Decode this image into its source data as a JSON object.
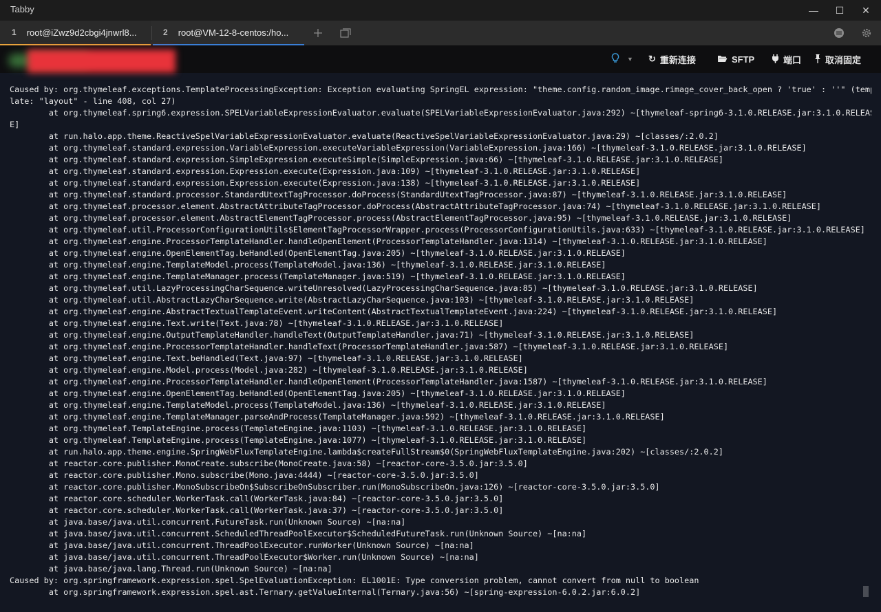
{
  "app": {
    "title": "Tabby"
  },
  "window_controls": {
    "minimize": "—",
    "maximize": "☐",
    "close": "✕"
  },
  "tabs": [
    {
      "index": "1",
      "label": "root@iZwz9d2cbgi4jnwrl8..."
    },
    {
      "index": "2",
      "label": "root@VM-12-8-centos:/ho..."
    }
  ],
  "toolbar": {
    "reconnect_label": "重新连接",
    "sftp_label": "SFTP",
    "ports_label": "端口",
    "unpin_label": "取消固定"
  },
  "terminal": {
    "lines": [
      "Caused by: org.thymeleaf.exceptions.TemplateProcessingException: Exception evaluating SpringEL expression: \"theme.config.random_image.rimage_cover_back_open ? 'true' : ''\" (temp",
      "late: \"layout\" - line 408, col 27)",
      "        at org.thymeleaf.spring6.expression.SPELVariableExpressionEvaluator.evaluate(SPELVariableExpressionEvaluator.java:292) ~[thymeleaf-spring6-3.1.0.RELEASE.jar:3.1.0.RELEAS",
      "E]",
      "        at run.halo.app.theme.ReactiveSpelVariableExpressionEvaluator.evaluate(ReactiveSpelVariableExpressionEvaluator.java:29) ~[classes/:2.0.2]",
      "        at org.thymeleaf.standard.expression.VariableExpression.executeVariableExpression(VariableExpression.java:166) ~[thymeleaf-3.1.0.RELEASE.jar:3.1.0.RELEASE]",
      "        at org.thymeleaf.standard.expression.SimpleExpression.executeSimple(SimpleExpression.java:66) ~[thymeleaf-3.1.0.RELEASE.jar:3.1.0.RELEASE]",
      "        at org.thymeleaf.standard.expression.Expression.execute(Expression.java:109) ~[thymeleaf-3.1.0.RELEASE.jar:3.1.0.RELEASE]",
      "        at org.thymeleaf.standard.expression.Expression.execute(Expression.java:138) ~[thymeleaf-3.1.0.RELEASE.jar:3.1.0.RELEASE]",
      "        at org.thymeleaf.standard.processor.StandardUtextTagProcessor.doProcess(StandardUtextTagProcessor.java:87) ~[thymeleaf-3.1.0.RELEASE.jar:3.1.0.RELEASE]",
      "        at org.thymeleaf.processor.element.AbstractAttributeTagProcessor.doProcess(AbstractAttributeTagProcessor.java:74) ~[thymeleaf-3.1.0.RELEASE.jar:3.1.0.RELEASE]",
      "        at org.thymeleaf.processor.element.AbstractElementTagProcessor.process(AbstractElementTagProcessor.java:95) ~[thymeleaf-3.1.0.RELEASE.jar:3.1.0.RELEASE]",
      "        at org.thymeleaf.util.ProcessorConfigurationUtils$ElementTagProcessorWrapper.process(ProcessorConfigurationUtils.java:633) ~[thymeleaf-3.1.0.RELEASE.jar:3.1.0.RELEASE]",
      "        at org.thymeleaf.engine.ProcessorTemplateHandler.handleOpenElement(ProcessorTemplateHandler.java:1314) ~[thymeleaf-3.1.0.RELEASE.jar:3.1.0.RELEASE]",
      "        at org.thymeleaf.engine.OpenElementTag.beHandled(OpenElementTag.java:205) ~[thymeleaf-3.1.0.RELEASE.jar:3.1.0.RELEASE]",
      "        at org.thymeleaf.engine.TemplateModel.process(TemplateModel.java:136) ~[thymeleaf-3.1.0.RELEASE.jar:3.1.0.RELEASE]",
      "        at org.thymeleaf.engine.TemplateManager.process(TemplateManager.java:519) ~[thymeleaf-3.1.0.RELEASE.jar:3.1.0.RELEASE]",
      "        at org.thymeleaf.util.LazyProcessingCharSequence.writeUnresolved(LazyProcessingCharSequence.java:85) ~[thymeleaf-3.1.0.RELEASE.jar:3.1.0.RELEASE]",
      "        at org.thymeleaf.util.AbstractLazyCharSequence.write(AbstractLazyCharSequence.java:103) ~[thymeleaf-3.1.0.RELEASE.jar:3.1.0.RELEASE]",
      "        at org.thymeleaf.engine.AbstractTextualTemplateEvent.writeContent(AbstractTextualTemplateEvent.java:224) ~[thymeleaf-3.1.0.RELEASE.jar:3.1.0.RELEASE]",
      "        at org.thymeleaf.engine.Text.write(Text.java:78) ~[thymeleaf-3.1.0.RELEASE.jar:3.1.0.RELEASE]",
      "        at org.thymeleaf.engine.OutputTemplateHandler.handleText(OutputTemplateHandler.java:71) ~[thymeleaf-3.1.0.RELEASE.jar:3.1.0.RELEASE]",
      "        at org.thymeleaf.engine.ProcessorTemplateHandler.handleText(ProcessorTemplateHandler.java:587) ~[thymeleaf-3.1.0.RELEASE.jar:3.1.0.RELEASE]",
      "        at org.thymeleaf.engine.Text.beHandled(Text.java:97) ~[thymeleaf-3.1.0.RELEASE.jar:3.1.0.RELEASE]",
      "        at org.thymeleaf.engine.Model.process(Model.java:282) ~[thymeleaf-3.1.0.RELEASE.jar:3.1.0.RELEASE]",
      "        at org.thymeleaf.engine.ProcessorTemplateHandler.handleOpenElement(ProcessorTemplateHandler.java:1587) ~[thymeleaf-3.1.0.RELEASE.jar:3.1.0.RELEASE]",
      "        at org.thymeleaf.engine.OpenElementTag.beHandled(OpenElementTag.java:205) ~[thymeleaf-3.1.0.RELEASE.jar:3.1.0.RELEASE]",
      "        at org.thymeleaf.engine.TemplateModel.process(TemplateModel.java:136) ~[thymeleaf-3.1.0.RELEASE.jar:3.1.0.RELEASE]",
      "        at org.thymeleaf.engine.TemplateManager.parseAndProcess(TemplateManager.java:592) ~[thymeleaf-3.1.0.RELEASE.jar:3.1.0.RELEASE]",
      "        at org.thymeleaf.TemplateEngine.process(TemplateEngine.java:1103) ~[thymeleaf-3.1.0.RELEASE.jar:3.1.0.RELEASE]",
      "        at org.thymeleaf.TemplateEngine.process(TemplateEngine.java:1077) ~[thymeleaf-3.1.0.RELEASE.jar:3.1.0.RELEASE]",
      "        at run.halo.app.theme.engine.SpringWebFluxTemplateEngine.lambda$createFullStream$0(SpringWebFluxTemplateEngine.java:202) ~[classes/:2.0.2]",
      "        at reactor.core.publisher.MonoCreate.subscribe(MonoCreate.java:58) ~[reactor-core-3.5.0.jar:3.5.0]",
      "        at reactor.core.publisher.Mono.subscribe(Mono.java:4444) ~[reactor-core-3.5.0.jar:3.5.0]",
      "        at reactor.core.publisher.MonoSubscribeOn$SubscribeOnSubscriber.run(MonoSubscribeOn.java:126) ~[reactor-core-3.5.0.jar:3.5.0]",
      "        at reactor.core.scheduler.WorkerTask.call(WorkerTask.java:84) ~[reactor-core-3.5.0.jar:3.5.0]",
      "        at reactor.core.scheduler.WorkerTask.call(WorkerTask.java:37) ~[reactor-core-3.5.0.jar:3.5.0]",
      "        at java.base/java.util.concurrent.FutureTask.run(Unknown Source) ~[na:na]",
      "        at java.base/java.util.concurrent.ScheduledThreadPoolExecutor$ScheduledFutureTask.run(Unknown Source) ~[na:na]",
      "        at java.base/java.util.concurrent.ThreadPoolExecutor.runWorker(Unknown Source) ~[na:na]",
      "        at java.base/java.util.concurrent.ThreadPoolExecutor$Worker.run(Unknown Source) ~[na:na]",
      "        at java.base/java.lang.Thread.run(Unknown Source) ~[na:na]",
      "Caused by: org.springframework.expression.spel.SpelEvaluationException: EL1001E: Type conversion problem, cannot convert from null to boolean",
      "        at org.springframework.expression.spel.ast.Ternary.getValueInternal(Ternary.java:56) ~[spring-expression-6.0.2.jar:6.0.2]"
    ]
  }
}
